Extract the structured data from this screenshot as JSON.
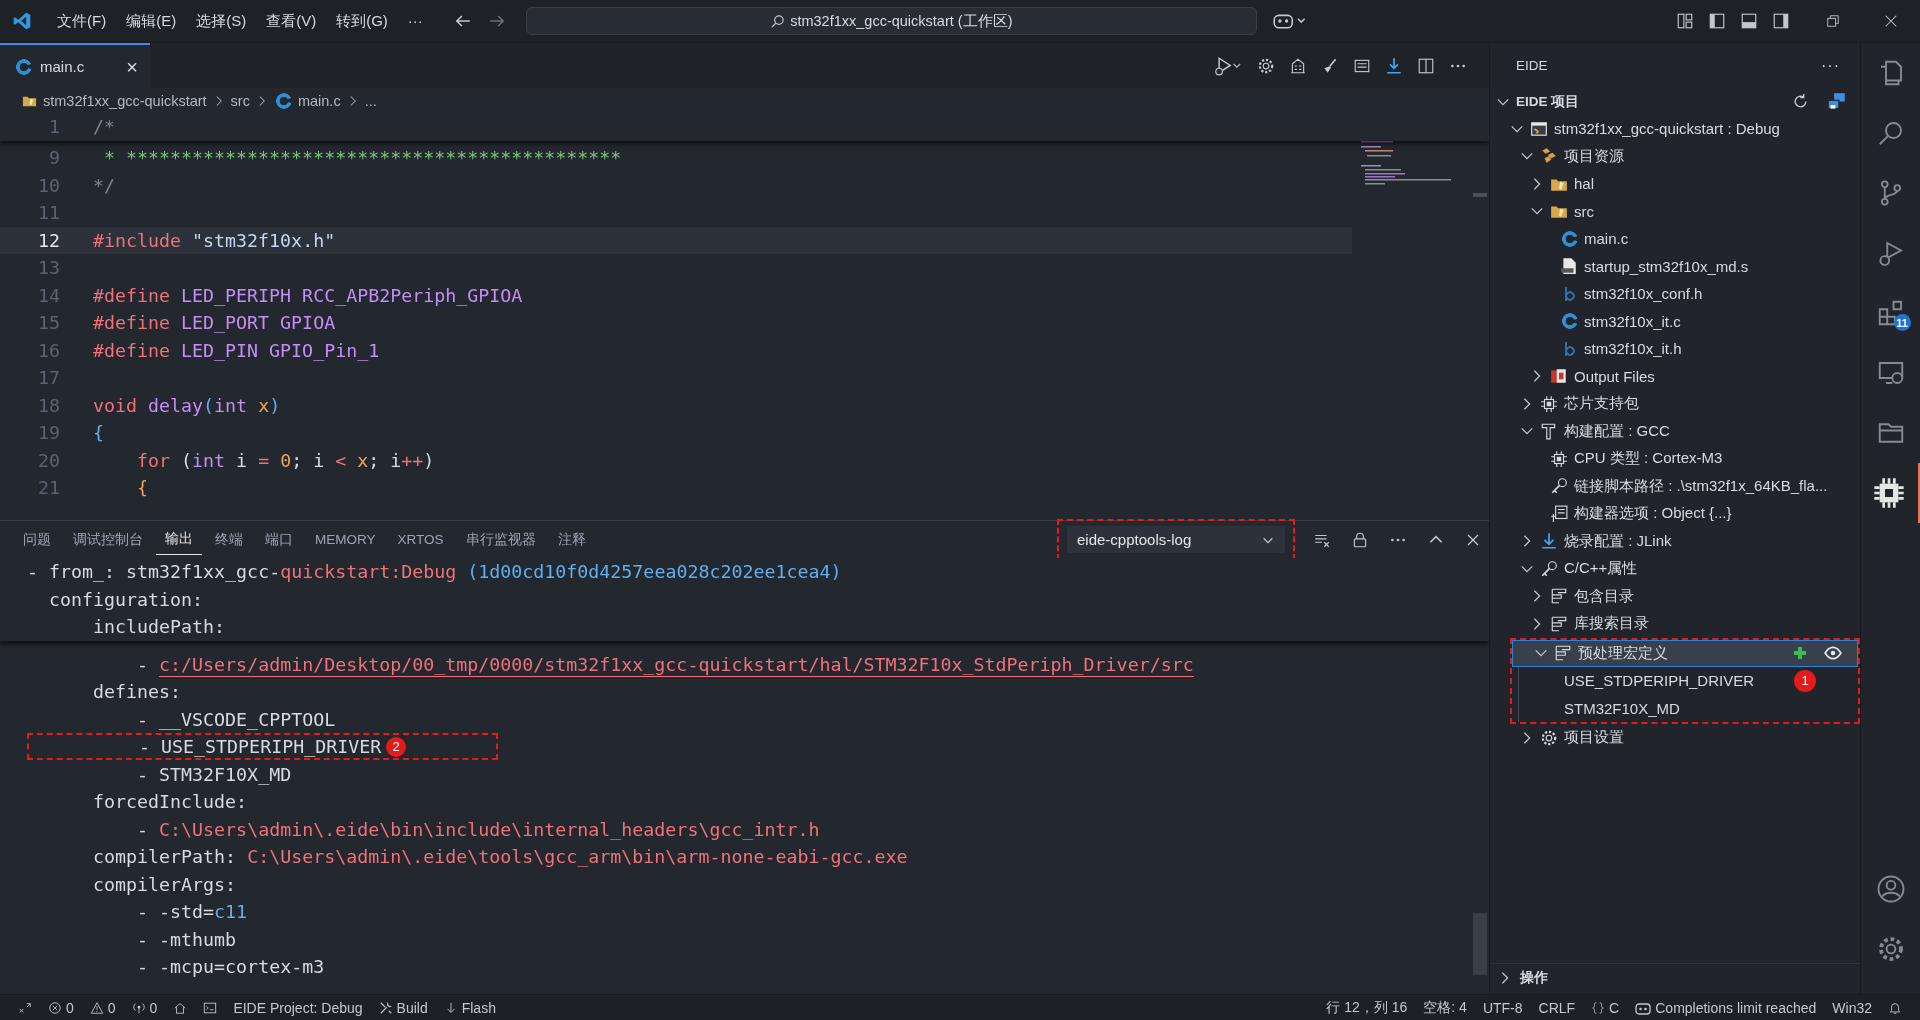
{
  "title_bar": {
    "menus": [
      "文件(F)",
      "编辑(E)",
      "选择(S)",
      "查看(V)",
      "转到(G)",
      "···"
    ],
    "search": "stm32f1xx_gcc-quickstart (工作区)"
  },
  "editor": {
    "tabs": [
      {
        "label": "main.c",
        "selected": true,
        "close": "×"
      }
    ],
    "breadcrumb": [
      "stm32f1xx_gcc-quickstart",
      "src",
      "main.c",
      "..."
    ],
    "sticky_lines": [
      {
        "number": "1",
        "tokens": [
          {
            "text": "/*",
            "kind": "comment"
          }
        ]
      }
    ],
    "lines": [
      {
        "number": "9",
        "current": false,
        "tokens": [
          {
            "text": " * *********************************************",
            "kind": "banner"
          }
        ]
      },
      {
        "number": "10",
        "current": false,
        "tokens": [
          {
            "text": "*/",
            "kind": "comment"
          }
        ]
      },
      {
        "number": "11",
        "current": false
      },
      {
        "number": "12",
        "current": true,
        "tokens": [
          {
            "text": "#include",
            "kind": "preproc"
          },
          {
            "text": " \"stm32f10x.h\"",
            "kind": "string"
          }
        ]
      },
      {
        "number": "13",
        "current": false
      },
      {
        "number": "14",
        "current": false,
        "tokens": [
          {
            "text": "#define",
            "kind": "preproc"
          },
          {
            "text": " LED_PERIPH RCC_APB2Periph_GPIOA",
            "kind": "macro"
          }
        ]
      },
      {
        "number": "15",
        "current": false,
        "tokens": [
          {
            "text": "#define",
            "kind": "preproc"
          },
          {
            "text": " LED_PORT GPIOA",
            "kind": "macro"
          }
        ]
      },
      {
        "number": "16",
        "current": false,
        "tokens": [
          {
            "text": "#define",
            "kind": "preproc"
          },
          {
            "text": " LED_PIN GPIO_Pin_1",
            "kind": "macro"
          }
        ]
      },
      {
        "number": "17",
        "current": false
      },
      {
        "number": "18",
        "current": false,
        "tokens": [
          {
            "text": "void",
            "kind": "keyword"
          },
          {
            "text": " delay",
            "kind": "func"
          },
          {
            "text": "(",
            "kind": "punct"
          },
          {
            "text": "int",
            "kind": "type"
          },
          {
            "text": " x",
            "kind": "param"
          },
          {
            "text": ")",
            "kind": "punct"
          }
        ]
      },
      {
        "number": "19",
        "current": false,
        "tokens": [
          {
            "text": "{",
            "kind": "punct"
          }
        ]
      },
      {
        "number": "20",
        "current": false,
        "tokens": [
          {
            "text": "    for",
            "kind": "keyword"
          },
          {
            "text": " (",
            "kind": "plain"
          },
          {
            "text": "int",
            "kind": "type"
          },
          {
            "text": " i ",
            "kind": "plain"
          },
          {
            "text": "=",
            "kind": "keyword"
          },
          {
            "text": " 0",
            "kind": "param"
          },
          {
            "text": "; i ",
            "kind": "plain"
          },
          {
            "text": "<",
            "kind": "keyword"
          },
          {
            "text": " x",
            "kind": "param"
          },
          {
            "text": "; i",
            "kind": "plain"
          },
          {
            "text": "++",
            "kind": "keyword"
          },
          {
            "text": ")",
            "kind": "plain"
          }
        ]
      },
      {
        "number": "21",
        "current": false,
        "tokens": [
          {
            "text": "    {",
            "kind": "param"
          }
        ]
      }
    ]
  },
  "panel": {
    "tabs": [
      {
        "label": "问题",
        "selected": false
      },
      {
        "label": "调试控制台",
        "selected": false
      },
      {
        "label": "输出",
        "selected": true
      },
      {
        "label": "终端",
        "selected": false
      },
      {
        "label": "端口",
        "selected": false
      },
      {
        "label": "MEMORY",
        "selected": false
      },
      {
        "label": "XRTOS",
        "selected": false
      },
      {
        "label": "串行监视器",
        "selected": false
      },
      {
        "label": "注释",
        "selected": false
      }
    ],
    "channel": {
      "value": "eide-cpptools-log",
      "highlighted": true
    },
    "sticky_lines": [
      {
        "tokens": [
          {
            "text": "- from_: stm32f1xx_gcc-",
            "kind": "plain"
          },
          {
            "text": "quickstart:Debug",
            "kind": "red"
          },
          {
            "text": " (1d00cd10f0d4257eea028c202ee1cea4)",
            "kind": "blue"
          }
        ]
      },
      {
        "tokens": [
          {
            "text": "  configuration:",
            "kind": "plain"
          }
        ]
      },
      {
        "tokens": [
          {
            "text": "      includePath:",
            "kind": "plain"
          }
        ]
      }
    ],
    "lines": [
      {
        "highlighted": false,
        "tokens": [
          {
            "text": "          - ",
            "kind": "plain"
          },
          {
            "text": "c:/Users/admin/Desktop/00_tmp/0000/stm32f1xx_gcc-quickstart/hal/STM32F10x_StdPeriph_Driver/src",
            "kind": "link"
          }
        ]
      },
      {
        "highlighted": false,
        "tokens": [
          {
            "text": "      defines:",
            "kind": "plain"
          }
        ]
      },
      {
        "highlighted": false,
        "tokens": [
          {
            "text": "          - __VSCODE_CPPTOOL",
            "kind": "plain"
          }
        ]
      },
      {
        "highlighted": true,
        "marker": "2",
        "tokens": [
          {
            "text": "          - USE_STDPERIPH_DRIVER",
            "kind": "plain"
          }
        ]
      },
      {
        "highlighted": false,
        "tokens": [
          {
            "text": "          - STM32F10X_MD",
            "kind": "plain"
          }
        ]
      },
      {
        "highlighted": false,
        "tokens": [
          {
            "text": "      forcedInclude:",
            "kind": "plain"
          }
        ]
      },
      {
        "highlighted": false,
        "tokens": [
          {
            "text": "          - ",
            "kind": "plain"
          },
          {
            "text": "C:\\Users\\admin\\.eide\\bin\\include\\internal_headers\\gcc_intr.h",
            "kind": "red"
          }
        ]
      },
      {
        "highlighted": false,
        "tokens": [
          {
            "text": "      compilerPath: ",
            "kind": "plain"
          },
          {
            "text": "C:\\Users\\admin\\.eide\\tools\\gcc_arm\\bin\\arm-none-eabi-gcc.exe",
            "kind": "red"
          }
        ]
      },
      {
        "highlighted": false,
        "tokens": [
          {
            "text": "      compilerArgs:",
            "kind": "plain"
          }
        ]
      },
      {
        "highlighted": false,
        "tokens": [
          {
            "text": "          - -std=",
            "kind": "plain"
          },
          {
            "text": "c11",
            "kind": "blue"
          }
        ]
      },
      {
        "highlighted": false,
        "tokens": [
          {
            "text": "          - -mthumb",
            "kind": "plain"
          }
        ]
      },
      {
        "highlighted": false,
        "tokens": [
          {
            "text": "          - -mcpu=cortex-m3",
            "kind": "plain"
          }
        ]
      }
    ]
  },
  "sidebar": {
    "title": "EIDE",
    "more": "···",
    "section": {
      "label": "EIDE 项目",
      "expanded": true
    },
    "tree": [
      {
        "label": "stm32f1xx_gcc-quickstart : Debug",
        "kind": "project",
        "expanded": true,
        "selected": false,
        "children": [
          {
            "label": "项目资源",
            "kind": "resources",
            "expanded": true,
            "selected": false,
            "children": [
              {
                "label": "hal",
                "kind": "folder",
                "expanded": false,
                "selected": false
              },
              {
                "label": "src",
                "kind": "folder",
                "expanded": true,
                "selected": false,
                "children": [
                  {
                    "label": "main.c",
                    "kind": "source",
                    "selected": false
                  },
                  {
                    "label": "startup_stm32f10x_md.s",
                    "kind": "assembly",
                    "selected": false
                  },
                  {
                    "label": "stm32f10x_conf.h",
                    "kind": "header",
                    "selected": false
                  },
                  {
                    "label": "stm32f10x_it.c",
                    "kind": "source",
                    "selected": false
                  },
                  {
                    "label": "stm32f10x_it.h",
                    "kind": "header",
                    "selected": false
                  }
                ]
              },
              {
                "label": "Output Files",
                "kind": "output",
                "expanded": false,
                "selected": false
              }
            ]
          },
          {
            "label": "芯片支持包",
            "kind": "chip",
            "expanded": false,
            "selected": false
          },
          {
            "label": "构建配置 : GCC",
            "kind": "builder",
            "expanded": true,
            "selected": false,
            "children": [
              {
                "label": "CPU 类型 : Cortex-M3",
                "kind": "chip",
                "selected": false
              },
              {
                "label": "链接脚本路径 : .\\stm32f1x_64KB_fla...",
                "kind": "key",
                "selected": false
              },
              {
                "label": "构建器选项 : Object {...}",
                "kind": "options",
                "selected": false
              }
            ]
          },
          {
            "label": "烧录配置 : JLink",
            "kind": "flasher",
            "expanded": false,
            "selected": false
          },
          {
            "label": "C/C++属性",
            "kind": "key",
            "expanded": true,
            "selected": false,
            "children": [
              {
                "label": "包含目录",
                "kind": "list",
                "expanded": false,
                "selected": false
              },
              {
                "label": "库搜索目录",
                "kind": "list",
                "expanded": false,
                "selected": false
              },
              {
                "label": "预处理宏定义",
                "kind": "list",
                "expanded": true,
                "selected": true,
                "highlighted": true,
                "children": [
                  {
                    "label": "USE_STDPERIPH_DRIVER",
                    "selected": false,
                    "marker": "1"
                  },
                  {
                    "label": "STM32F10X_MD",
                    "selected": false
                  }
                ]
              }
            ]
          },
          {
            "label": "项目设置",
            "kind": "settings",
            "expanded": false,
            "selected": false
          }
        ]
      }
    ],
    "bottom_section": {
      "label": "操作",
      "expanded": false
    }
  },
  "activity_bar": [
    {
      "kind": "files",
      "selected": false
    },
    {
      "kind": "search",
      "selected": false
    },
    {
      "kind": "branch",
      "selected": false
    },
    {
      "kind": "debug",
      "selected": false
    },
    {
      "kind": "extensions",
      "selected": false,
      "badge": "11"
    },
    {
      "kind": "remote",
      "selected": false
    },
    {
      "kind": "folder",
      "selected": false
    },
    {
      "kind": "chip",
      "selected": true
    }
  ],
  "status_bar": {
    "left": [
      {
        "kind": "remote"
      },
      {
        "kind": "errors",
        "text": "0"
      },
      {
        "kind": "warnings",
        "text": "0"
      },
      {
        "kind": "radio",
        "text": "0"
      },
      {
        "kind": "home"
      },
      {
        "kind": "terminal"
      },
      {
        "kind": "plain",
        "text": "EIDE Project: Debug"
      },
      {
        "kind": "tools",
        "text": "Build"
      },
      {
        "kind": "arrow",
        "text": "Flash"
      }
    ],
    "right": [
      {
        "kind": "plain",
        "text": "行 12，列 16"
      },
      {
        "kind": "plain",
        "text": "空格: 4"
      },
      {
        "kind": "plain",
        "text": "UTF-8"
      },
      {
        "kind": "plain",
        "text": "CRLF"
      },
      {
        "kind": "braces",
        "text": "C"
      },
      {
        "kind": "copilot",
        "text": "Completions limit reached"
      },
      {
        "kind": "plain",
        "text": "Win32"
      },
      {
        "kind": "bell"
      }
    ]
  }
}
